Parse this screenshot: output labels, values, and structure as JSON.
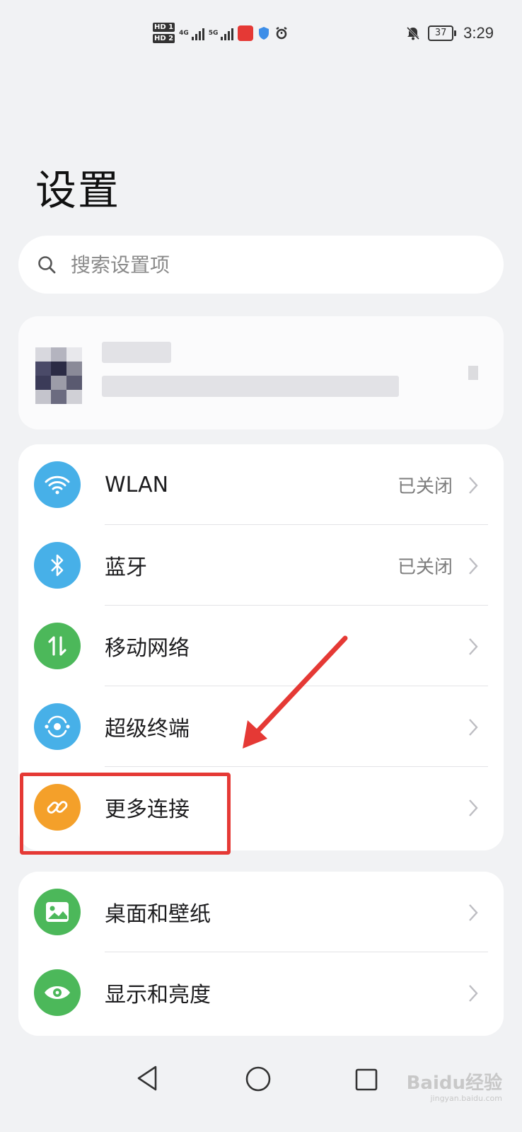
{
  "status_bar": {
    "sim1": "HD 1",
    "sim2": "HD 2",
    "net1": "4G",
    "net2": "5G",
    "battery": "37",
    "time": "3:29",
    "icons": [
      "signal-icon",
      "app-notification-icon",
      "shield-icon",
      "alarm-icon",
      "mute-bell-icon",
      "battery-icon"
    ]
  },
  "page": {
    "title": "设置"
  },
  "search": {
    "placeholder": "搜索设置项"
  },
  "connectivity_group": [
    {
      "label": "WLAN",
      "value": "已关闭",
      "icon": "wifi-icon",
      "color": "#47b0e8"
    },
    {
      "label": "蓝牙",
      "value": "已关闭",
      "icon": "bluetooth-icon",
      "color": "#47b0e8"
    },
    {
      "label": "移动网络",
      "value": "",
      "icon": "mobile-data-icon",
      "color": "#4cb85a"
    },
    {
      "label": "超级终端",
      "value": "",
      "icon": "super-device-icon",
      "color": "#47b0e8"
    },
    {
      "label": "更多连接",
      "value": "",
      "icon": "link-icon",
      "color": "#f4a02a"
    }
  ],
  "display_group": [
    {
      "label": "桌面和壁纸",
      "value": "",
      "icon": "wallpaper-icon",
      "color": "#4cb85a"
    },
    {
      "label": "显示和亮度",
      "value": "",
      "icon": "eye-icon",
      "color": "#4cb85a"
    }
  ],
  "annotation_color": "#e53935",
  "watermark": {
    "text": "Baidu经验",
    "sub": "jingyan.baidu.com"
  }
}
